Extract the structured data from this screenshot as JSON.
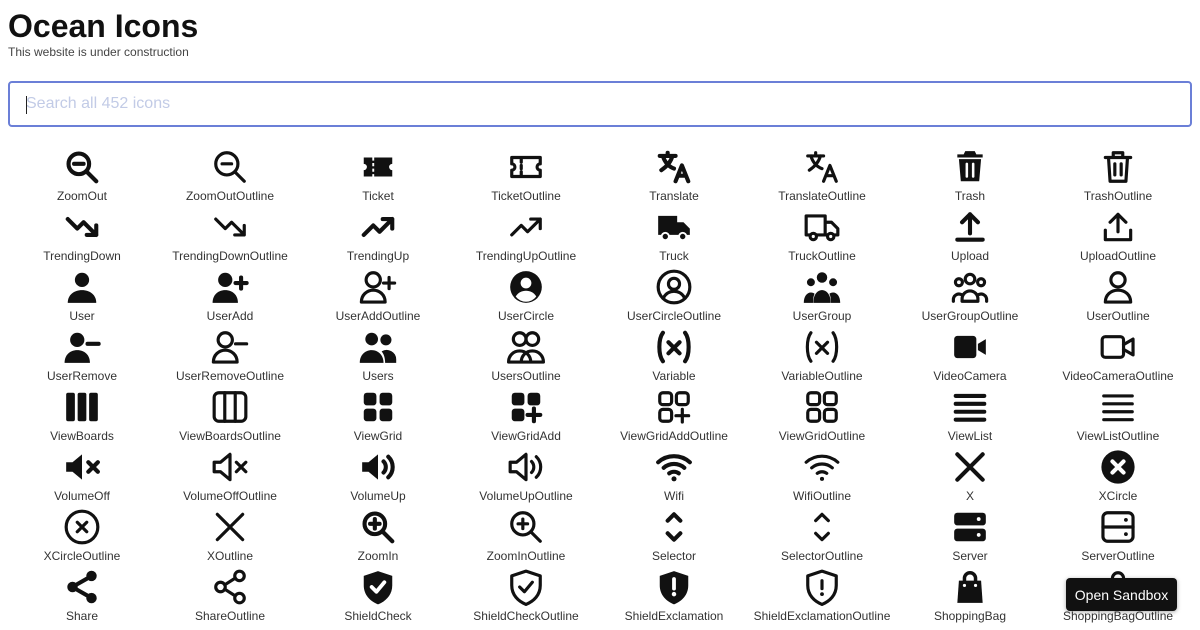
{
  "header": {
    "title": "Ocean Icons",
    "subtitle": "This website is under construction"
  },
  "search": {
    "placeholder": "Search all 452 icons",
    "value": ""
  },
  "icons": [
    {
      "label": "ZoomOut",
      "icon": "zoom-out"
    },
    {
      "label": "ZoomOutOutline",
      "icon": "zoom-out-outline"
    },
    {
      "label": "Ticket",
      "icon": "ticket"
    },
    {
      "label": "TicketOutline",
      "icon": "ticket-outline"
    },
    {
      "label": "Translate",
      "icon": "translate"
    },
    {
      "label": "TranslateOutline",
      "icon": "translate-outline"
    },
    {
      "label": "Trash",
      "icon": "trash"
    },
    {
      "label": "TrashOutline",
      "icon": "trash-outline"
    },
    {
      "label": "TrendingDown",
      "icon": "trending-down"
    },
    {
      "label": "TrendingDownOutline",
      "icon": "trending-down-outline"
    },
    {
      "label": "TrendingUp",
      "icon": "trending-up"
    },
    {
      "label": "TrendingUpOutline",
      "icon": "trending-up-outline"
    },
    {
      "label": "Truck",
      "icon": "truck"
    },
    {
      "label": "TruckOutline",
      "icon": "truck-outline"
    },
    {
      "label": "Upload",
      "icon": "upload"
    },
    {
      "label": "UploadOutline",
      "icon": "upload-outline"
    },
    {
      "label": "User",
      "icon": "user"
    },
    {
      "label": "UserAdd",
      "icon": "user-add"
    },
    {
      "label": "UserAddOutline",
      "icon": "user-add-outline"
    },
    {
      "label": "UserCircle",
      "icon": "user-circle"
    },
    {
      "label": "UserCircleOutline",
      "icon": "user-circle-outline"
    },
    {
      "label": "UserGroup",
      "icon": "user-group"
    },
    {
      "label": "UserGroupOutline",
      "icon": "user-group-outline"
    },
    {
      "label": "UserOutline",
      "icon": "user-outline"
    },
    {
      "label": "UserRemove",
      "icon": "user-remove"
    },
    {
      "label": "UserRemoveOutline",
      "icon": "user-remove-outline"
    },
    {
      "label": "Users",
      "icon": "users"
    },
    {
      "label": "UsersOutline",
      "icon": "users-outline"
    },
    {
      "label": "Variable",
      "icon": "variable"
    },
    {
      "label": "VariableOutline",
      "icon": "variable-outline"
    },
    {
      "label": "VideoCamera",
      "icon": "video-camera"
    },
    {
      "label": "VideoCameraOutline",
      "icon": "video-camera-outline"
    },
    {
      "label": "ViewBoards",
      "icon": "view-boards"
    },
    {
      "label": "ViewBoardsOutline",
      "icon": "view-boards-outline"
    },
    {
      "label": "ViewGrid",
      "icon": "view-grid"
    },
    {
      "label": "ViewGridAdd",
      "icon": "view-grid-add"
    },
    {
      "label": "ViewGridAddOutline",
      "icon": "view-grid-add-outline"
    },
    {
      "label": "ViewGridOutline",
      "icon": "view-grid-outline"
    },
    {
      "label": "ViewList",
      "icon": "view-list"
    },
    {
      "label": "ViewListOutline",
      "icon": "view-list-outline"
    },
    {
      "label": "VolumeOff",
      "icon": "volume-off"
    },
    {
      "label": "VolumeOffOutline",
      "icon": "volume-off-outline"
    },
    {
      "label": "VolumeUp",
      "icon": "volume-up"
    },
    {
      "label": "VolumeUpOutline",
      "icon": "volume-up-outline"
    },
    {
      "label": "Wifi",
      "icon": "wifi"
    },
    {
      "label": "WifiOutline",
      "icon": "wifi-outline"
    },
    {
      "label": "X",
      "icon": "x"
    },
    {
      "label": "XCircle",
      "icon": "x-circle"
    },
    {
      "label": "XCircleOutline",
      "icon": "x-circle-outline"
    },
    {
      "label": "XOutline",
      "icon": "x-outline"
    },
    {
      "label": "ZoomIn",
      "icon": "zoom-in"
    },
    {
      "label": "ZoomInOutline",
      "icon": "zoom-in-outline"
    },
    {
      "label": "Selector",
      "icon": "selector"
    },
    {
      "label": "SelectorOutline",
      "icon": "selector-outline"
    },
    {
      "label": "Server",
      "icon": "server"
    },
    {
      "label": "ServerOutline",
      "icon": "server-outline"
    },
    {
      "label": "Share",
      "icon": "share"
    },
    {
      "label": "ShareOutline",
      "icon": "share-outline"
    },
    {
      "label": "ShieldCheck",
      "icon": "shield-check"
    },
    {
      "label": "ShieldCheckOutline",
      "icon": "shield-check-outline"
    },
    {
      "label": "ShieldExclamation",
      "icon": "shield-exclamation"
    },
    {
      "label": "ShieldExclamationOutline",
      "icon": "shield-exclamation-outline"
    },
    {
      "label": "ShoppingBag",
      "icon": "shopping-bag"
    },
    {
      "label": "ShoppingBagOutline",
      "icon": "shopping-bag-outline"
    }
  ],
  "sandbox_button": {
    "label": "Open Sandbox"
  }
}
